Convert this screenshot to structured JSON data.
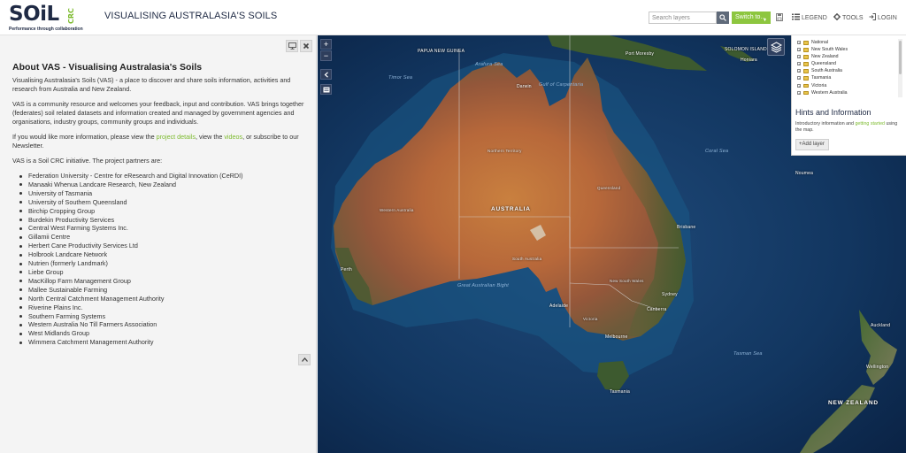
{
  "header": {
    "logo_word": "SOiL",
    "logo_crc": "CRC",
    "logo_tagline": "Performance through collaboration",
    "site_title": "VISUALISING AUSTRALASIA'S SOILS",
    "search_placeholder": "Search layers",
    "switch_label": "Switch to...",
    "legend_label": "LEGEND",
    "tools_label": "TOOLS",
    "login_label": "LOGIN"
  },
  "about": {
    "title": "About VAS - Visualising Australasia's Soils",
    "p1": "Visualising Australasia's Soils (VAS) - a place to discover and share soils information, activities and research from Australia and New Zealand.",
    "p2": "VAS is a community resource and welcomes your feedback, input and contribution. VAS brings together (federates) soil related datasets and information created and managed by government agencies and organisations, industry groups, community groups and individuals.",
    "p3_pre": "If you would like more information, please view the ",
    "p3_link1": "project details",
    "p3_mid": ", view the ",
    "p3_link2": "videos",
    "p3_post": ", or subscribe to our Newsletter.",
    "p4": "VAS is a Soil CRC initiative. The project partners are:",
    "partners": [
      "Federation University - Centre for eResearch and Digital Innovation (CeRDI)",
      "Manaaki Whenua Landcare Research, New Zealand",
      "University of Tasmania",
      "University of Southern Queensland",
      "Birchip Cropping Group",
      "Burdekin Productivity Services",
      "Central West Farming Systems Inc.",
      "Gillamii Centre",
      "Herbert Cane Productivity Services Ltd",
      "Holbrook Landcare Network",
      "Nutrien (formerly Landmark)",
      "Liebe Group",
      "MacKillop Farm Management Group",
      "Mallee Sustainable Farming",
      "North Central Catchment Management Authority",
      "Riverine Plains Inc.",
      "Southern Farming Systems",
      "Western Australia No Till Farmers Association",
      "West Midlands Group",
      "Wimmera Catchment Management Authority"
    ]
  },
  "map": {
    "zoom_in": "+",
    "zoom_out": "−",
    "labels": {
      "australia": "AUSTRALIA",
      "new_zealand": "NEW ZEALAND",
      "solomon": "SOLOMON ISLANDS",
      "png": "PAPUA NEW GUINEA",
      "port_moresby": "Port Moresby",
      "honiara": "Honiara",
      "coral_sea": "Coral Sea",
      "tasman_sea": "Tasman Sea",
      "brisbane": "Brisbane",
      "sydney": "Sydney",
      "canberra": "Canberra",
      "melbourne": "Melbourne",
      "adelaide": "Adelaide",
      "hobart": "Tasmania",
      "perth": "Perth",
      "darwin": "Darwin",
      "wellington": "Wellington",
      "auckland": "Auckland",
      "queensland": "Queensland",
      "nsw": "New South Wales",
      "victoria": "Victoria",
      "south_australia": "South Australia",
      "western_australia": "Western Australia",
      "northern_territory": "Northern Territory",
      "great_australian_bight": "Great Australian Bight",
      "gulf_carpentaria": "Gulf of Carpentaria",
      "arafura": "Arafura Sea",
      "timor": "Timor Sea",
      "noumea": "Noumea"
    }
  },
  "layers": {
    "items": [
      "National",
      "New South Wales",
      "New Zealand",
      "Queensland",
      "South Australia",
      "Tasmania",
      "Victoria",
      "Western Australia"
    ],
    "hints_title": "Hints and Information",
    "hints_pre": "Introductory information and ",
    "hints_link": "getting started",
    "hints_post": " using the map.",
    "add_layer": "Add layer"
  },
  "colors": {
    "accent_green": "#8dc63f",
    "navy": "#1f2a44",
    "ocean": "#0d2b52"
  }
}
